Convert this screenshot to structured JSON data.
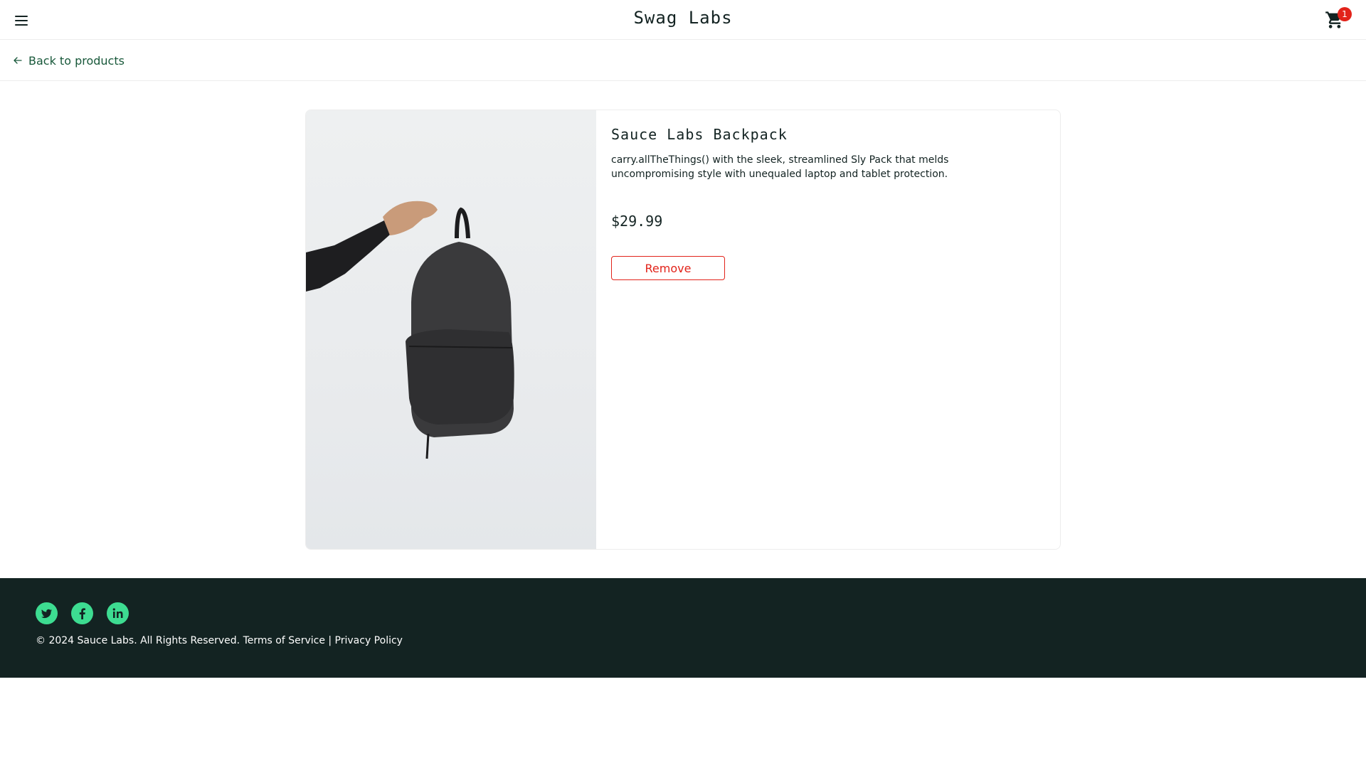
{
  "header": {
    "app_logo": "Swag Labs",
    "menu_icon": "hamburger-menu-icon",
    "cart_icon": "shopping-cart-icon",
    "cart_badge": "1"
  },
  "secondary_header": {
    "back_label": "Back to products",
    "back_icon": "arrow-left-icon"
  },
  "product": {
    "name": "Sauce Labs Backpack",
    "description": "carry.allTheThings() with the sleek, streamlined Sly Pack that melds uncompromising style with unequaled laptop and tablet protection.",
    "price": "$29.99",
    "remove_label": "Remove"
  },
  "footer": {
    "social": [
      "twitter-icon",
      "facebook-icon",
      "linkedin-icon"
    ],
    "copy": "© 2024 Sauce Labs. All Rights Reserved. Terms of Service | Privacy Policy"
  },
  "colors": {
    "brand_dark": "#132322",
    "link_green": "#18583a",
    "social_green": "#3ddc91",
    "danger_red": "#e2231a",
    "border": "#ededed"
  }
}
